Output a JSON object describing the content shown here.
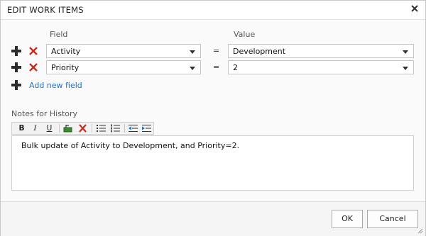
{
  "dialog": {
    "title": "EDIT WORK ITEMS",
    "close_icon": "close-icon"
  },
  "fields": {
    "field_header": "Field",
    "value_header": "Value",
    "rows": [
      {
        "field": "Activity",
        "operator": "=",
        "value": "Development"
      },
      {
        "field": "Priority",
        "operator": "=",
        "value": "2"
      }
    ],
    "add_label": "Add new field",
    "add_icon": "plus-icon",
    "remove_icon": "remove-icon"
  },
  "notes": {
    "label": "Notes for History",
    "toolbar": [
      {
        "icon": "bold-icon",
        "glyph": "B"
      },
      {
        "icon": "italic-icon",
        "glyph": "I"
      },
      {
        "icon": "underline-icon",
        "glyph": "U"
      },
      {
        "icon": "insert-link-icon"
      },
      {
        "icon": "clear-format-icon"
      },
      {
        "icon": "bulleted-list-icon"
      },
      {
        "icon": "numbered-list-icon"
      },
      {
        "icon": "decrease-indent-icon"
      },
      {
        "icon": "increase-indent-icon"
      }
    ],
    "text": "Bulk update of Activity to Development, and Priority=2."
  },
  "footer": {
    "ok_label": "OK",
    "cancel_label": "Cancel"
  },
  "colors": {
    "link": "#1f6fc5",
    "remove_red": "#c62b1c",
    "plus_dark": "#2b2b2b"
  }
}
